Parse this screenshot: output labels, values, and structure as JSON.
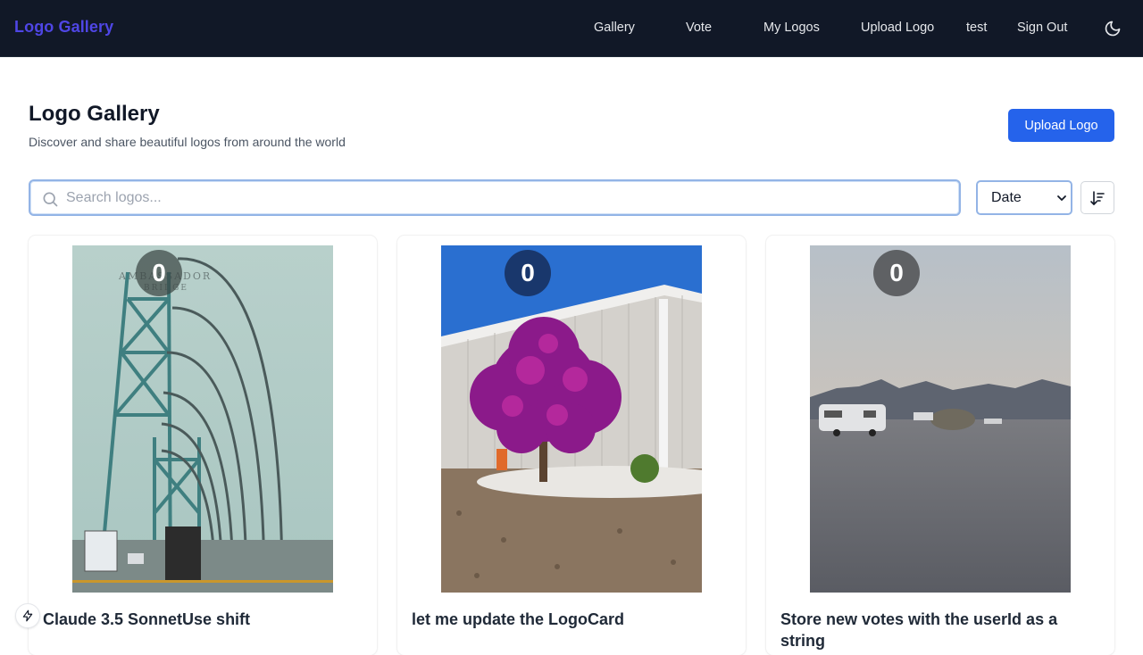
{
  "nav": {
    "brand": "Logo Gallery",
    "links": [
      "Gallery",
      "Vote",
      "My Logos",
      "Upload Logo",
      "test",
      "Sign Out"
    ],
    "theme_icon": "moon-icon"
  },
  "header": {
    "title": "Logo Gallery",
    "subtitle": "Discover and share beautiful logos from around the world",
    "upload_label": "Upload Logo"
  },
  "search": {
    "placeholder": "Search logos...",
    "value": ""
  },
  "sort": {
    "selected": "Date",
    "direction_icon": "sort-descending-icon"
  },
  "cards": [
    {
      "title": "Claude 3.5 SonnetUse shift",
      "votes": "0",
      "image": "bridge-photo"
    },
    {
      "title": "let me update the LogoCard",
      "votes": "0",
      "image": "flowering-tree-photo"
    },
    {
      "title": "Store new votes with the userId as a string",
      "votes": "0",
      "image": "desert-camp-photo"
    }
  ],
  "colors": {
    "nav_bg": "#111827",
    "brand": "#4f46e5",
    "primary": "#2563eb"
  }
}
